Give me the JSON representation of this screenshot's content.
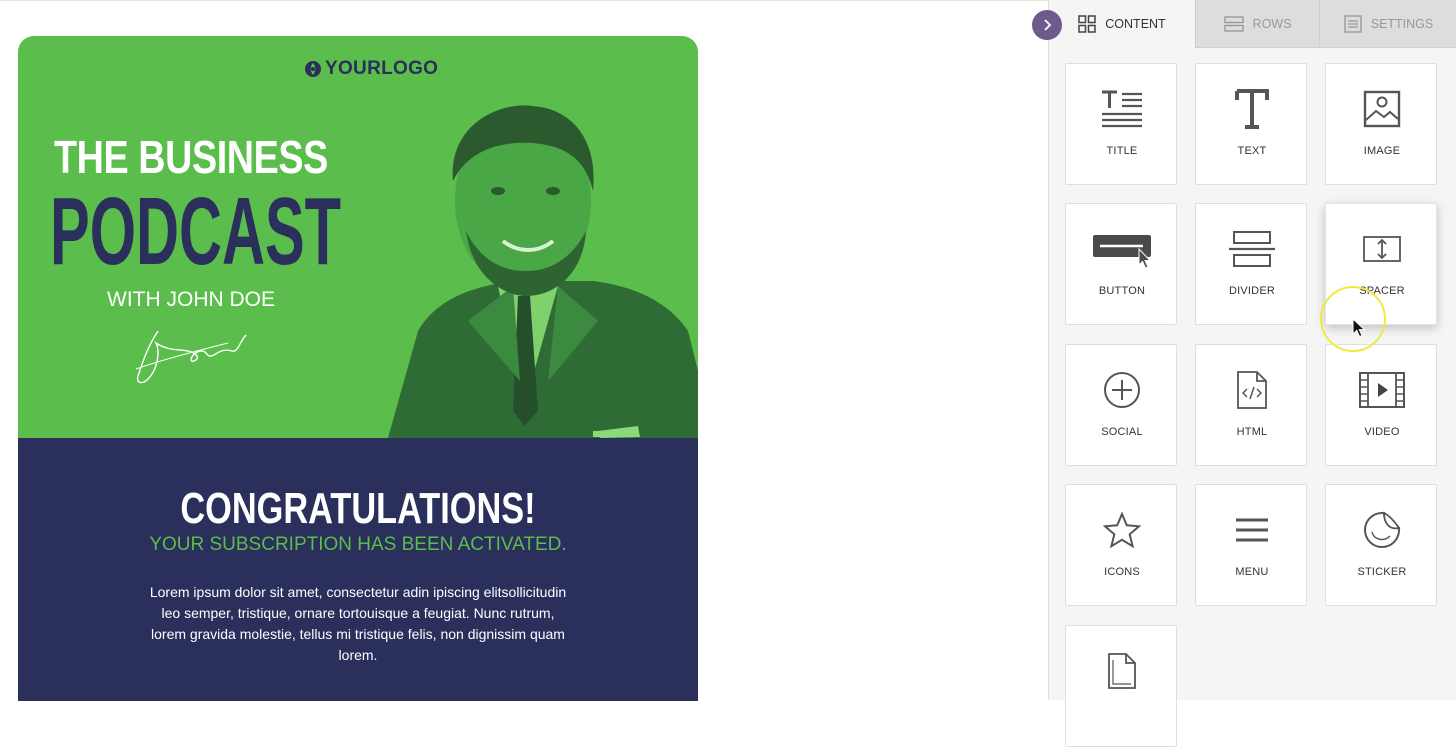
{
  "email": {
    "logo_text": "YOURLOGO",
    "title_line1": "THE BUSINESS",
    "title_line2": "PODCAST",
    "title_line3": "WITH JOHN DOE",
    "heading": "CONGRATULATIONS!",
    "subheading": "YOUR SUBSCRIPTION HAS BEEN ACTIVATED.",
    "body_text": "Lorem ipsum dolor sit amet, consectetur adin ipiscing elitsollicitudin leo semper, tristique, ornare tortouisque a feugiat. Nunc rutrum, lorem gravida molestie, tellus mi tristique felis, non dignissim quam lorem.",
    "colors": {
      "green": "#5bbd4c",
      "navy": "#2b2f5b"
    }
  },
  "panel": {
    "collapse_icon": "chevron-right-icon",
    "tabs": [
      {
        "label": "CONTENT",
        "icon": "grid-icon",
        "active": true
      },
      {
        "label": "ROWS",
        "icon": "rows-icon",
        "active": false
      },
      {
        "label": "SETTINGS",
        "icon": "settings-doc-icon",
        "active": false
      }
    ],
    "blocks": [
      {
        "label": "TITLE",
        "icon": "title-icon"
      },
      {
        "label": "TEXT",
        "icon": "text-icon"
      },
      {
        "label": "IMAGE",
        "icon": "image-icon"
      },
      {
        "label": "BUTTON",
        "icon": "button-icon"
      },
      {
        "label": "DIVIDER",
        "icon": "divider-icon"
      },
      {
        "label": "SPACER",
        "icon": "spacer-icon"
      },
      {
        "label": "SOCIAL",
        "icon": "social-plus-icon"
      },
      {
        "label": "HTML",
        "icon": "html-file-icon"
      },
      {
        "label": "VIDEO",
        "icon": "video-film-icon"
      },
      {
        "label": "ICONS",
        "icon": "star-icon"
      },
      {
        "label": "MENU",
        "icon": "menu-icon"
      },
      {
        "label": "STICKER",
        "icon": "sticker-icon"
      },
      {
        "label": "",
        "icon": "file-icon"
      }
    ]
  }
}
